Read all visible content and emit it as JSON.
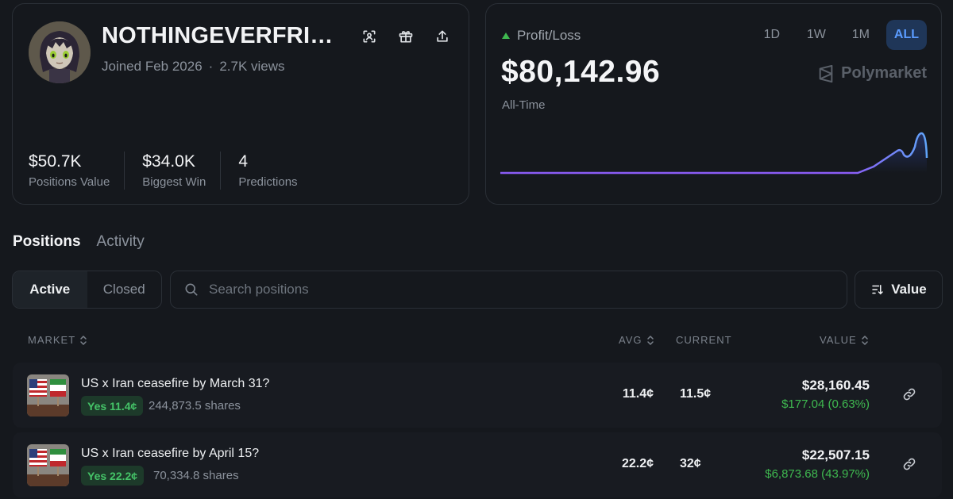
{
  "profile": {
    "username": "NOTHINGEVERFRIC...",
    "joined": "Joined Feb 2026",
    "separator": "·",
    "views": "2.7K views",
    "stats": [
      {
        "value": "$50.7K",
        "label": "Positions Value"
      },
      {
        "value": "$34.0K",
        "label": "Biggest Win"
      },
      {
        "value": "4",
        "label": "Predictions"
      }
    ],
    "icons": [
      "scan-icon",
      "gift-icon",
      "share-icon"
    ]
  },
  "pnl": {
    "label": "Profit/Loss",
    "value": "$80,142.96",
    "period": "All-Time",
    "brand": "Polymarket",
    "ranges": [
      "1D",
      "1W",
      "1M",
      "ALL"
    ],
    "active_range": "ALL",
    "colors": {
      "line_start": "#8b5cf6",
      "line_end": "#60a5fa",
      "up": "#3fb950"
    }
  },
  "tabs": {
    "positions": "Positions",
    "activity": "Activity"
  },
  "filters": {
    "active": "Active",
    "closed": "Closed",
    "search_placeholder": "Search positions",
    "sort_label": "Value"
  },
  "table": {
    "headers": {
      "market": "MARKET",
      "avg": "AVG",
      "current": "CURRENT",
      "value": "VALUE"
    },
    "rows": [
      {
        "title": "US x Iran ceasefire by March 31?",
        "outcome": "Yes 11.4¢",
        "shares": "244,873.5 shares",
        "avg": "11.4¢",
        "current": "11.5¢",
        "value": "$28,160.45",
        "pnl": "$177.04 (0.63%)"
      },
      {
        "title": "US x Iran ceasefire by April 15?",
        "outcome": "Yes 22.2¢",
        "shares": "70,334.8 shares",
        "avg": "22.2¢",
        "current": "32¢",
        "value": "$22,507.15",
        "pnl": "$6,873.68 (43.97%)"
      }
    ]
  }
}
